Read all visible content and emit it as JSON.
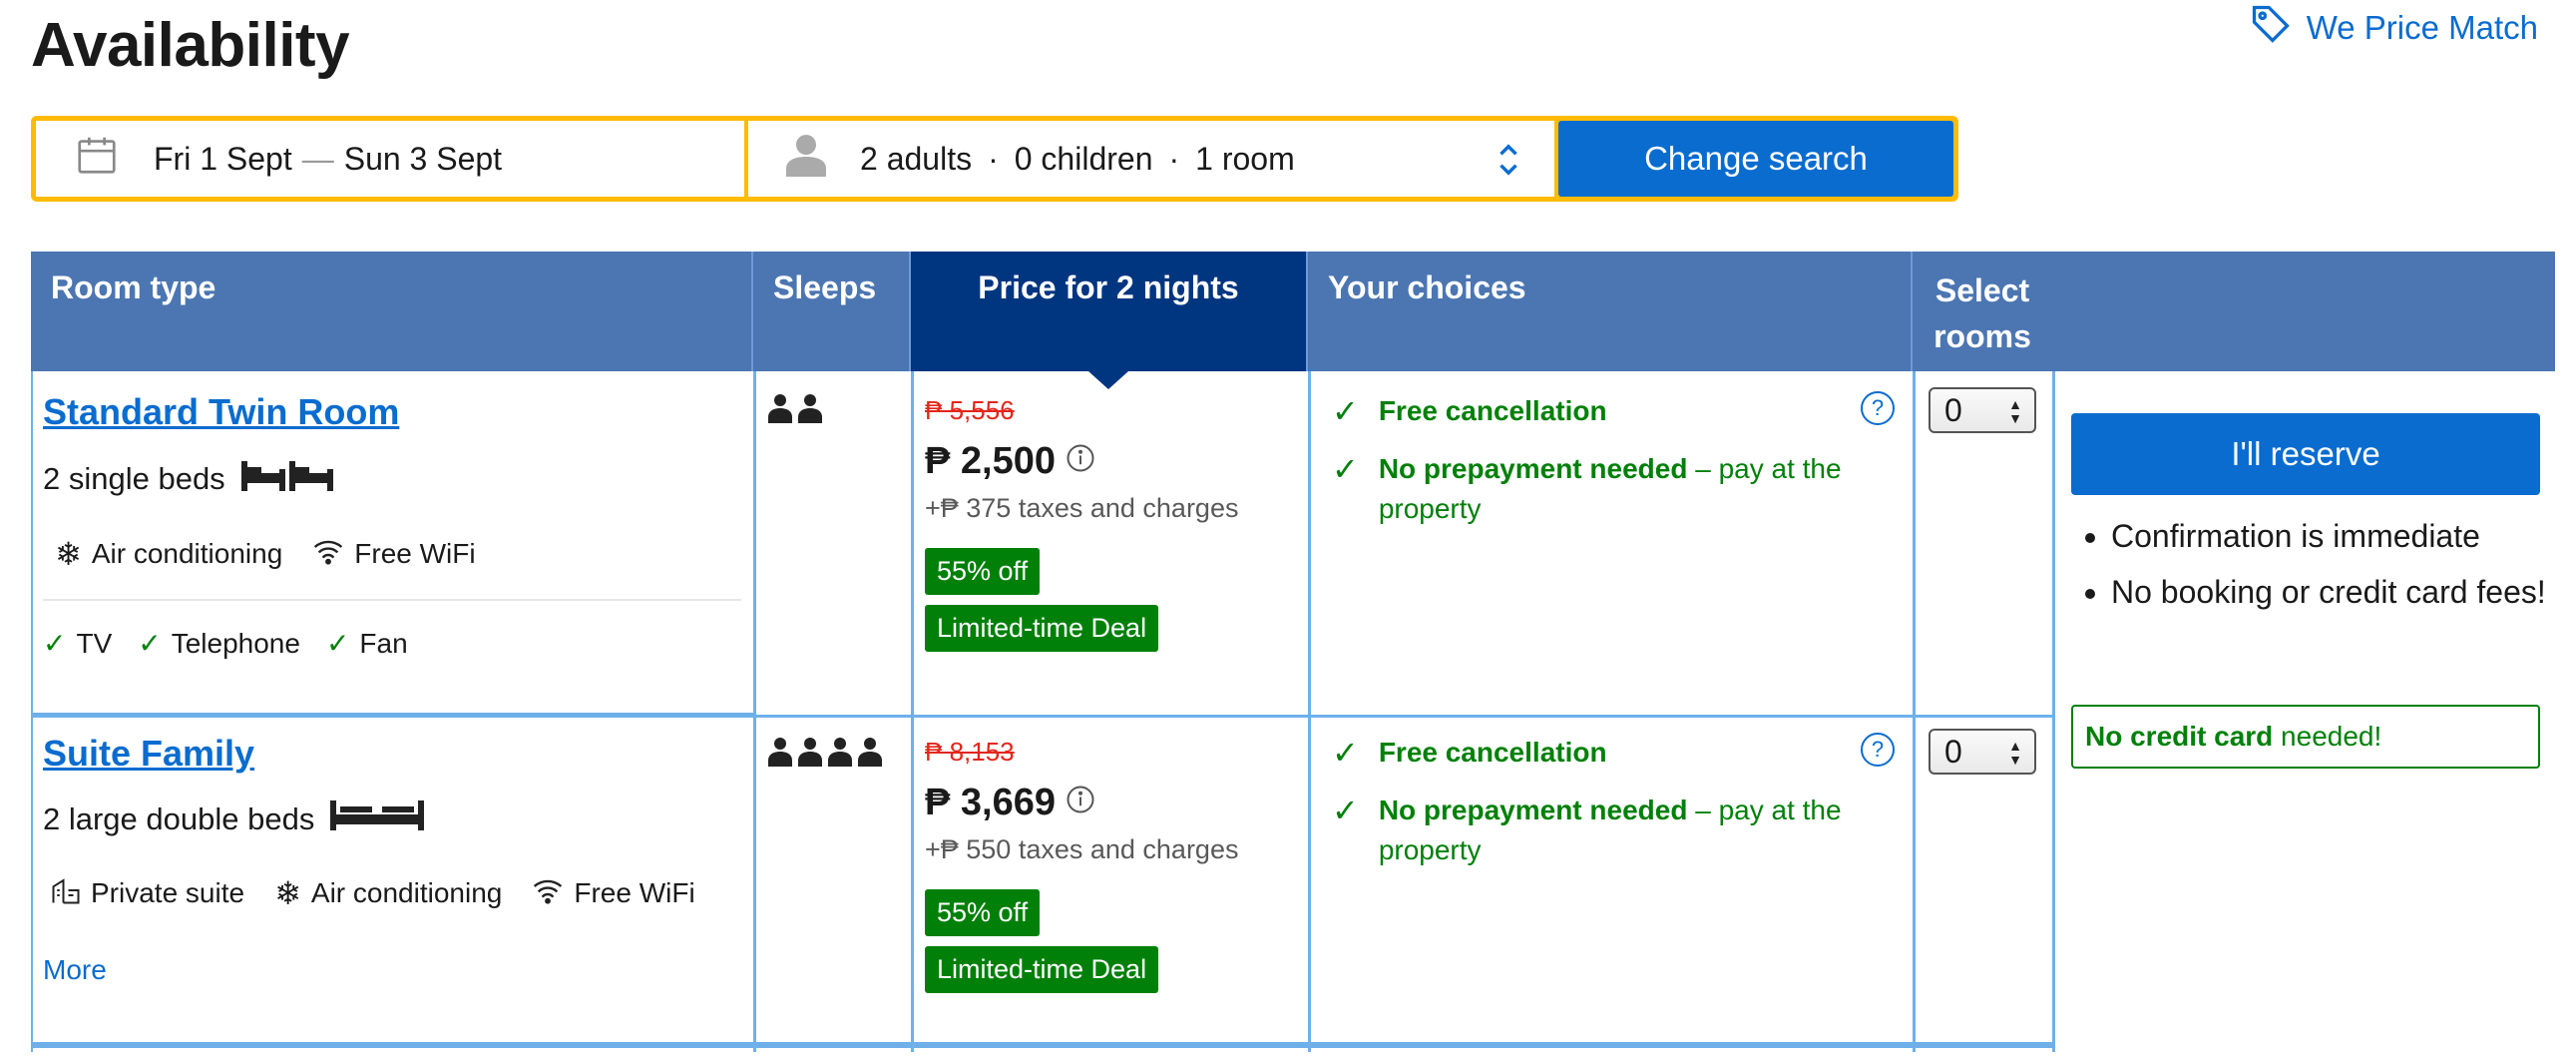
{
  "header": {
    "title": "Availability",
    "price_match": "We Price Match"
  },
  "search": {
    "date_from": "Fri 1 Sept",
    "date_sep": "—",
    "date_to": "Sun 3 Sept",
    "adults": "2 adults",
    "children": "0 children",
    "rooms": "1 room",
    "dot": "·",
    "button": "Change search"
  },
  "table": {
    "headers": {
      "room_type": "Room type",
      "sleeps": "Sleeps",
      "price": "Price for 2 nights",
      "choices": "Your choices",
      "select": "Select rooms"
    },
    "rows": [
      {
        "name": "Standard Twin Room",
        "beds": "2 single beds",
        "facilities": [
          "Air conditioning",
          "Free WiFi"
        ],
        "extras": [
          "TV",
          "Telephone",
          "Fan"
        ],
        "sleeps": 2,
        "old_price": "₱ 5,556",
        "price": "₱ 2,500",
        "taxes": "+₱ 375 taxes and charges",
        "discount": "55% off",
        "deal": "Limited-time Deal",
        "choice1": "Free cancellation",
        "choice2_bold": "No prepayment needed",
        "choice2_rest": " – pay at the property",
        "select_value": "0"
      },
      {
        "name": "Suite Family",
        "beds": "2 large double beds",
        "facilities": [
          "Private suite",
          "Air conditioning",
          "Free WiFi"
        ],
        "more": "More",
        "sleeps": 4,
        "old_price": "₱ 8,153",
        "price": "₱ 3,669",
        "taxes": "+₱ 550 taxes and charges",
        "discount": "55% off",
        "deal": "Limited-time Deal",
        "choice1": "Free cancellation",
        "choice2_bold": "No prepayment needed",
        "choice2_rest": " – pay at the property",
        "select_value": "0"
      }
    ]
  },
  "reserve": {
    "button": "I'll reserve",
    "bullets": [
      "Confirmation is immediate",
      "No booking or credit card fees!"
    ],
    "no_cc_bold": "No credit card",
    "no_cc_rest": " needed!"
  },
  "colors": {
    "brand_blue": "#0a6ccf",
    "header_blue": "#4c76b2",
    "dark_blue": "#003580",
    "green": "#008009",
    "red": "#e3261b",
    "yellow": "#febb02"
  }
}
